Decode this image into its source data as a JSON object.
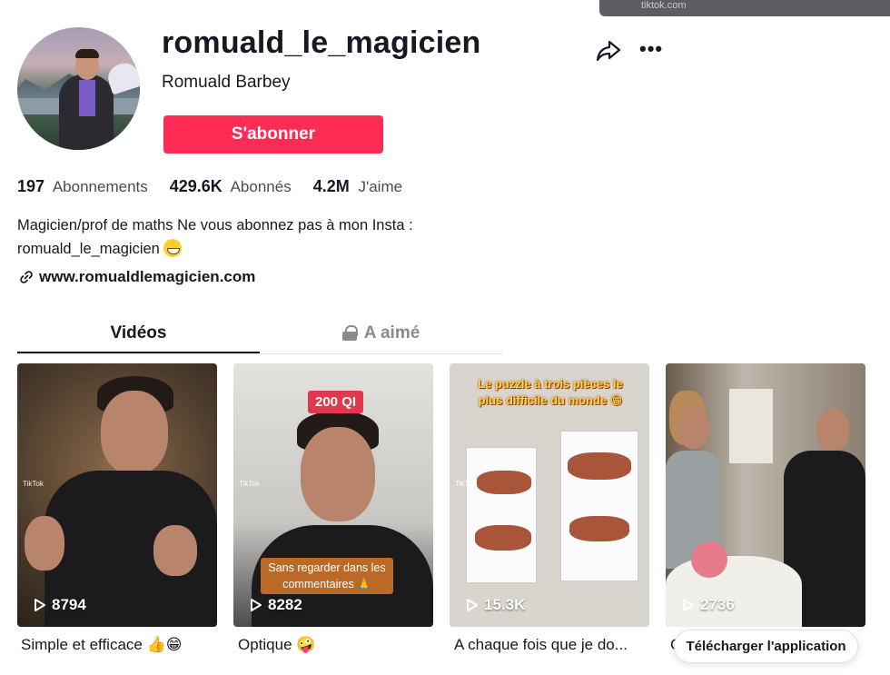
{
  "tooltip": {
    "text": "tiktok.com"
  },
  "profile": {
    "username": "romuald_le_magicien",
    "nickname": "Romuald Barbey",
    "follow_label": "S'abonner",
    "bio_line1": "Magicien/prof de maths Ne vous abonnez pas à mon Insta :",
    "bio_line2": "romuald_le_magicien",
    "link": "www.romualdlemagicien.com"
  },
  "stats": [
    {
      "value": "197",
      "label": "Abonnements"
    },
    {
      "value": "429.6K",
      "label": "Abonnés"
    },
    {
      "value": "4.2M",
      "label": "J'aime"
    }
  ],
  "tabs": [
    {
      "label": "Vidéos",
      "active": true
    },
    {
      "label": "A aimé",
      "locked": true
    }
  ],
  "videos": [
    {
      "plays": "8794",
      "caption": "Simple et efficace 👍😁",
      "overlay": "TikTok"
    },
    {
      "plays": "8282",
      "caption": "Optique 🤪",
      "tag_top": "200 QI",
      "tag_bottom": "Sans regarder dans les commentaires 🙏",
      "overlay": "TikTok"
    },
    {
      "plays": "15.3K",
      "caption": "A chaque fois que je do...",
      "title": "Le puzzle à trois pièces le plus difficile du monde 😁",
      "overlay": "TikTok"
    },
    {
      "plays": "2736",
      "caption": "C"
    }
  ],
  "download_label": "Télécharger l'application",
  "colors": {
    "accent": "#fe2c55",
    "text": "#161823",
    "muted": "#8a8b91"
  }
}
